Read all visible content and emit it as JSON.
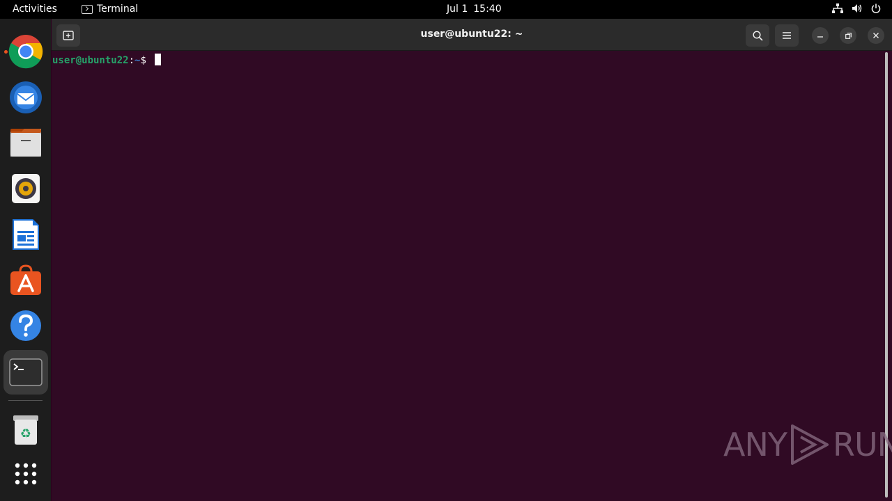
{
  "topbar": {
    "activities": "Activities",
    "app_name": "Terminal",
    "date": "Jul 1",
    "time": "15:40"
  },
  "dock": {
    "items": [
      {
        "name": "Google Chrome",
        "icon": "chrome-icon",
        "running": true
      },
      {
        "name": "Thunderbird Mail",
        "icon": "thunderbird-icon",
        "running": false
      },
      {
        "name": "Files",
        "icon": "files-icon",
        "running": false
      },
      {
        "name": "Rhythmbox",
        "icon": "rhythmbox-icon",
        "running": false
      },
      {
        "name": "LibreOffice Writer",
        "icon": "writer-icon",
        "running": false
      },
      {
        "name": "Ubuntu Software",
        "icon": "software-icon",
        "running": false
      },
      {
        "name": "Help",
        "icon": "help-icon",
        "running": false
      },
      {
        "name": "Terminal",
        "icon": "terminal-icon",
        "running": true
      },
      {
        "name": "Trash",
        "icon": "trash-icon",
        "running": false
      },
      {
        "name": "Show Applications",
        "icon": "app-grid-icon",
        "running": false
      }
    ]
  },
  "window": {
    "title": "user@ubuntu22: ~",
    "new_tab_icon": "new-tab-icon",
    "search_icon": "search-icon",
    "menu_icon": "hamburger-menu-icon"
  },
  "terminal": {
    "user_host": "user@ubuntu22",
    "colon": ":",
    "path": "~",
    "symbol": "$ "
  },
  "watermark": {
    "left": "ANY",
    "right": "RUN"
  },
  "colors": {
    "terminal_bg": "#300a24",
    "prompt_user": "#26a269",
    "prompt_path": "#3b78c3",
    "accent": "#e95420"
  }
}
